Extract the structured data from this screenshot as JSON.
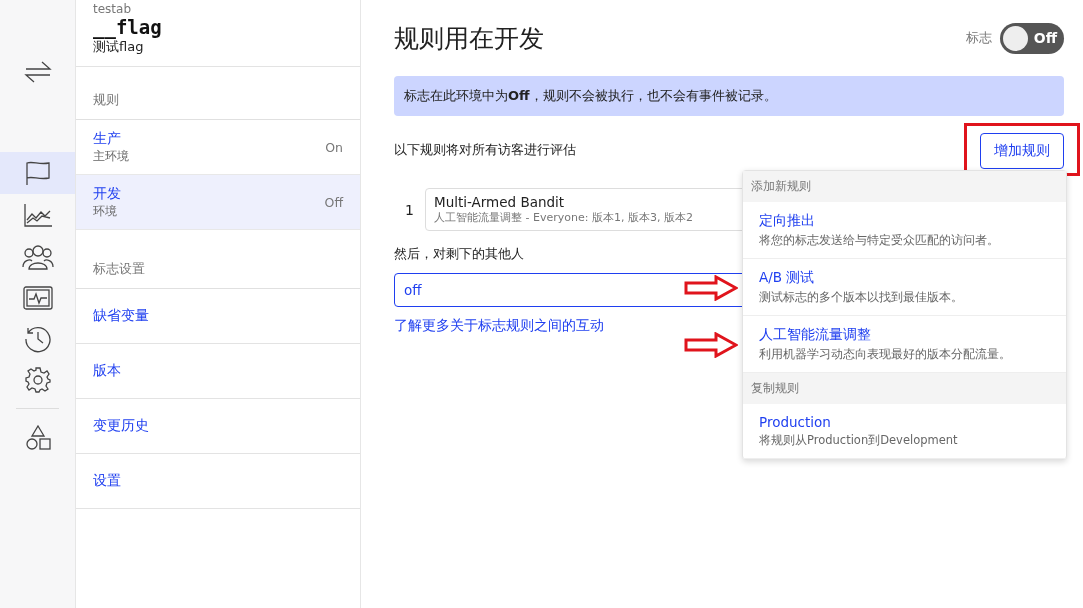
{
  "rail": {
    "items": [
      {
        "kind": "swap",
        "selected": false
      },
      {
        "kind": "flag",
        "selected": true
      },
      {
        "kind": "chart",
        "selected": false
      },
      {
        "kind": "users",
        "selected": false
      },
      {
        "kind": "monitor",
        "selected": false
      },
      {
        "kind": "history",
        "selected": false
      },
      {
        "kind": "gear",
        "selected": false
      },
      {
        "kind": "shapes",
        "selected": false
      }
    ]
  },
  "flag_header": {
    "project": "testab",
    "key": "__flag",
    "name": "测试flag"
  },
  "rules_section": {
    "label": "规则",
    "environments": [
      {
        "name": "生产",
        "description": "主环境",
        "status": "On",
        "selected": false
      },
      {
        "name": "开发",
        "description": "环境",
        "status": "Off",
        "selected": true
      }
    ]
  },
  "settings_section": {
    "label": "标志设置",
    "items": [
      "缺省变量",
      "版本",
      "变更历史",
      "设置"
    ]
  },
  "main": {
    "title": "规则用在开发",
    "toggle": {
      "label": "标志",
      "on": false,
      "text": "Off"
    },
    "banner": "标志在此环境中为**Off**，规则不会被执行，也不会有事件被记录。",
    "rules_intro": "以下规则将对所有访客进行评估",
    "add_rule_button": "增加规则",
    "rules": [
      {
        "index": "1",
        "name": "Multi-Armed Bandit",
        "summary": "人工智能流量调整 - Everyone: 版本1, 版本3, 版本2"
      }
    ],
    "fallback_label": "然后，对剩下的其他人",
    "fallback_value": "off",
    "learn_more_link": "了解更多关于标志规则之间的互动"
  },
  "add_rule_menu": {
    "sections": [
      {
        "heading": "添加新规则",
        "options": [
          {
            "title": "定向推出",
            "description": "将您的标志发送给与特定受众匹配的访问者。",
            "annotated": false
          },
          {
            "title": "A/B 测试",
            "description": "测试标志的多个版本以找到最佳版本。",
            "annotated": true
          },
          {
            "title": "人工智能流量调整",
            "description": "利用机器学习动态向表现最好的版本分配流量。",
            "annotated": true
          }
        ]
      },
      {
        "heading": "复制规则",
        "options": [
          {
            "title": "Production",
            "description": "将规则从Production到Development",
            "annotated": false
          }
        ]
      }
    ]
  }
}
